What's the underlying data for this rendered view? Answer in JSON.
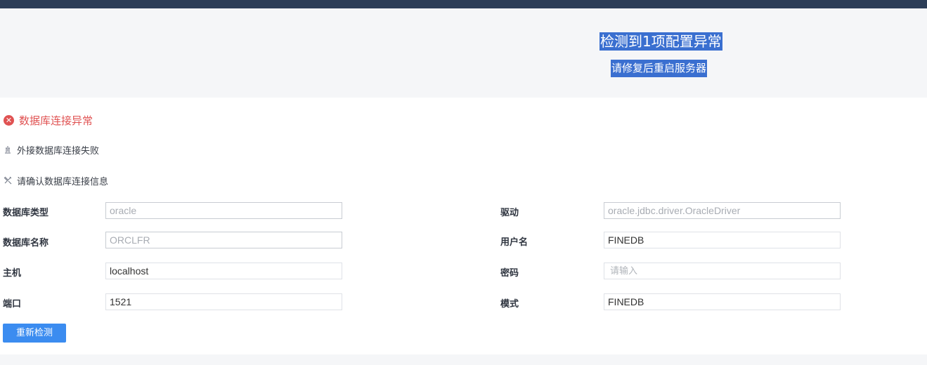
{
  "banner": {
    "title": "检测到1项配置异常",
    "subtitle": "请修复后重启服务器"
  },
  "error": {
    "icon": "close-circle-icon",
    "title": "数据库连接异常",
    "color": "#e05252"
  },
  "info": {
    "reason": "外接数据库连接失败",
    "suggestion": "请确认数据库连接信息"
  },
  "form": {
    "db_type_label": "数据库类型",
    "db_type_value": "oracle",
    "driver_label": "驱动",
    "driver_value": "oracle.jdbc.driver.OracleDriver",
    "db_name_label": "数据库名称",
    "db_name_value": "ORCLFR",
    "username_label": "用户名",
    "username_value": "FINEDB",
    "host_label": "主机",
    "host_value": "localhost",
    "password_label": "密码",
    "password_placeholder": "请输入",
    "port_label": "端口",
    "port_value": "1521",
    "schema_label": "模式",
    "schema_value": "FINEDB"
  },
  "actions": {
    "recheck_label": "重新检测",
    "accent": "#3b8cf0"
  }
}
